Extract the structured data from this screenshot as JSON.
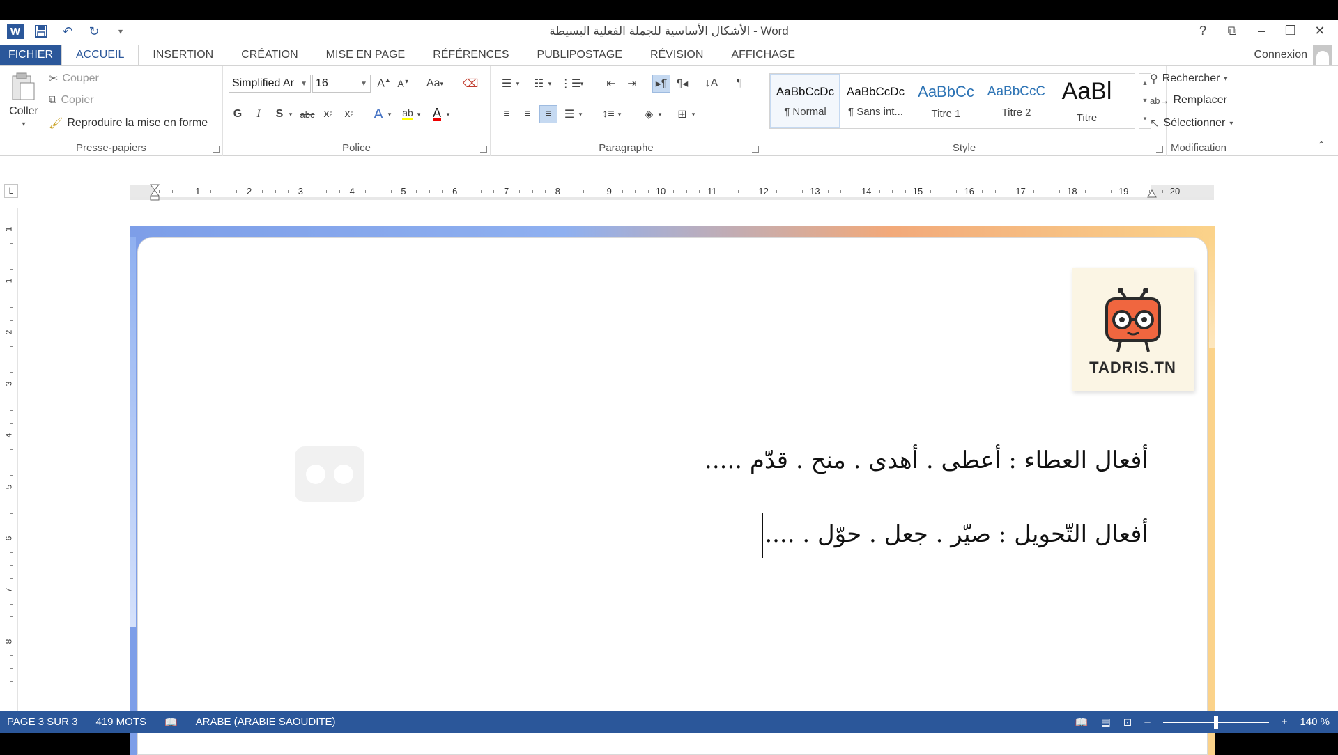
{
  "window": {
    "title": "الأشكال الأساسية للجملة الفعلية البسيطة - Word",
    "logo": "W"
  },
  "tabs": [
    {
      "label": "FICHIER"
    },
    {
      "label": "ACCUEIL"
    },
    {
      "label": "INSERTION"
    },
    {
      "label": "CRÉATION"
    },
    {
      "label": "MISE EN PAGE"
    },
    {
      "label": "RÉFÉRENCES"
    },
    {
      "label": "PUBLIPOSTAGE"
    },
    {
      "label": "RÉVISION"
    },
    {
      "label": "AFFICHAGE"
    }
  ],
  "signin": "Connexion",
  "clipboard": {
    "paste": "Coller",
    "cut": "Couper",
    "copy": "Copier",
    "format_painter": "Reproduire la mise en forme",
    "label": "Presse-papiers"
  },
  "font": {
    "name": "Simplified Ar",
    "size": "16",
    "label": "Police",
    "bold": "G",
    "italic": "I",
    "underline": "S",
    "change_case": "Aa"
  },
  "paragraph": {
    "label": "Paragraphe"
  },
  "styles": {
    "label": "Style",
    "items": [
      {
        "preview": "AaBbCcDc",
        "name": "¶ Normal"
      },
      {
        "preview": "AaBbCcDc",
        "name": "¶ Sans int..."
      },
      {
        "preview": "AaBbCc",
        "name": "Titre 1"
      },
      {
        "preview": "AaBbCcC",
        "name": "Titre 2"
      },
      {
        "preview": "AaBl",
        "name": "Titre"
      }
    ]
  },
  "editing": {
    "label": "Modification",
    "find": "Rechercher",
    "replace": "Remplacer",
    "select": "Sélectionner"
  },
  "ruler": {
    "tab_selector": "L",
    "h_numbers": [
      "1",
      "2",
      "3",
      "4",
      "5",
      "6",
      "7",
      "8",
      "9",
      "10",
      "11",
      "12",
      "13",
      "14",
      "15",
      "16",
      "17",
      "18",
      "19",
      "20"
    ],
    "v_numbers": [
      "1",
      "1",
      "2",
      "3",
      "4",
      "5",
      "6",
      "7",
      "8"
    ]
  },
  "document": {
    "logo_text": "TADRIS.TN",
    "lines": [
      "أفعال العطاء : أعطى . أهدى . منح . قدّم .....",
      "أفعال التّحويل : صيّر . جعل . حوّل . ...."
    ]
  },
  "status": {
    "page": "PAGE 3 SUR 3",
    "words": "419 MOTS",
    "language": "ARABE (ARABIE SAOUDITE)",
    "zoom": "140 %",
    "zoom_level_percent": 50
  },
  "colors": {
    "accent": "#2b579a",
    "title_style": "#2e74b5"
  }
}
